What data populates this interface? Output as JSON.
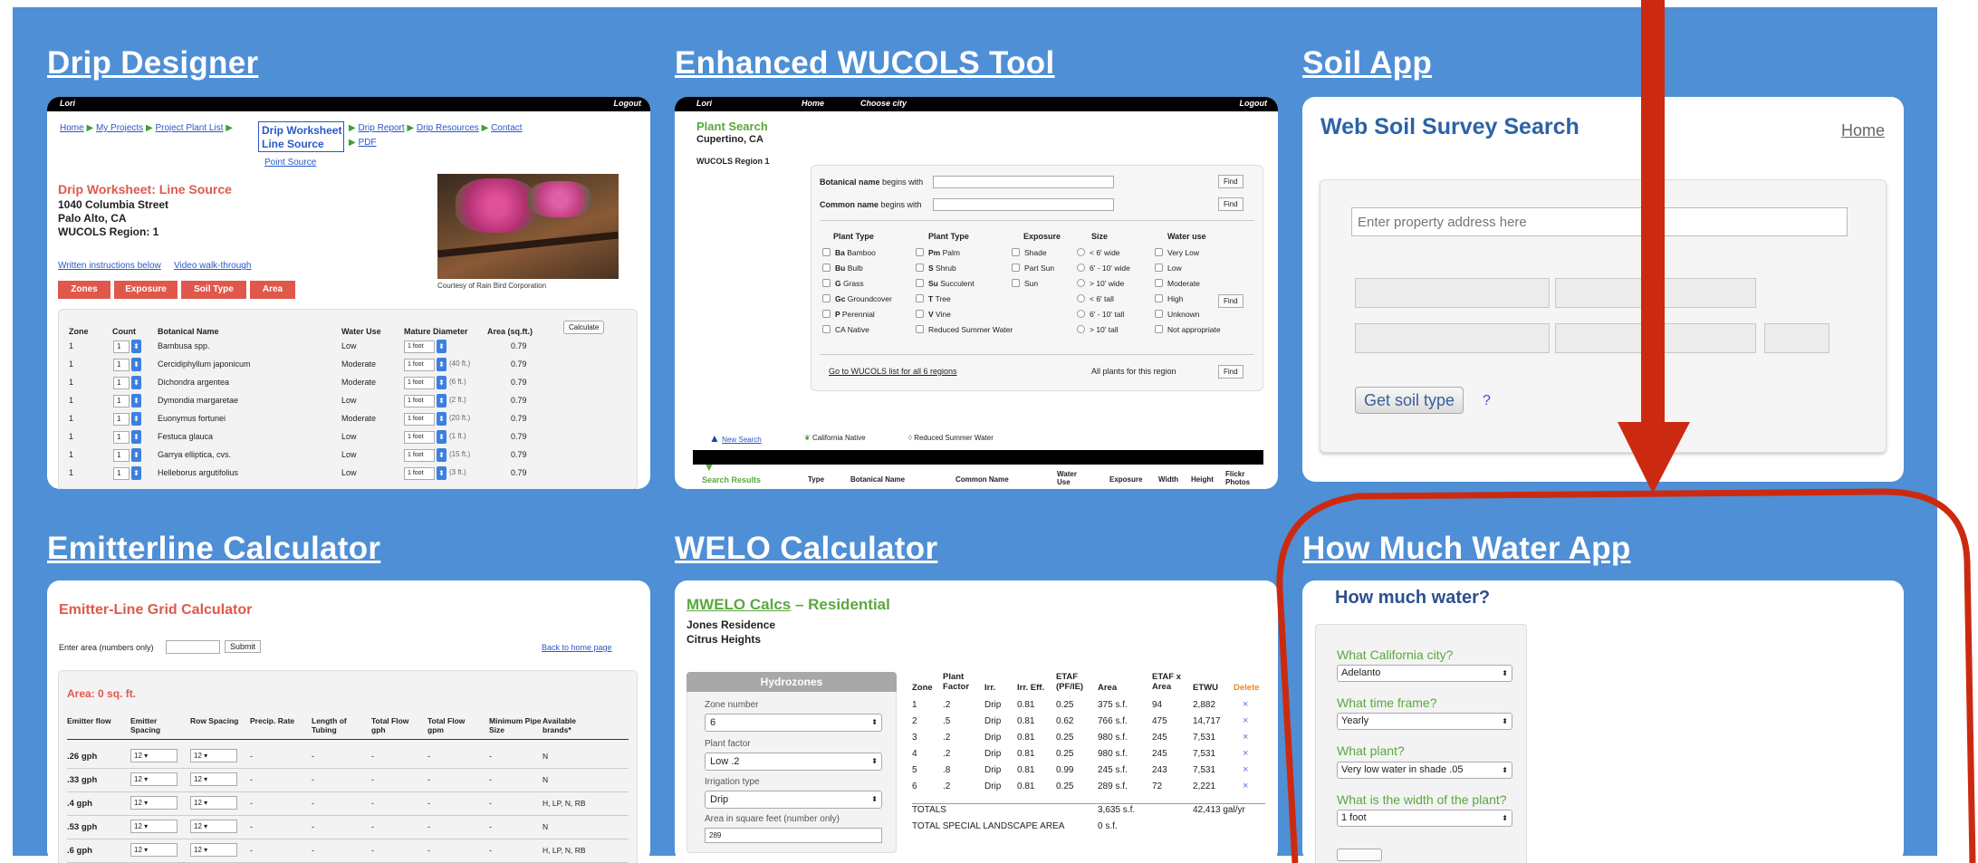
{
  "panels": {
    "drip": "Drip Designer",
    "wucols": "Enhanced WUCOLS Tool",
    "soil": "Soil App",
    "emitter": "Emitterline Calculator",
    "welo": "WELO Calculator",
    "howmuch": "How Much Water App"
  },
  "drip_designer": {
    "bar_left": "Lori",
    "bar_right": "Logout",
    "breadcrumb": [
      "Home",
      "My Projects",
      "Project Plant List"
    ],
    "active_crumb_1": "Drip Worksheet",
    "active_crumb_2": "Line Source",
    "crumb_more": [
      "Drip Report",
      "Drip Resources",
      "Contact"
    ],
    "pdf": "PDF",
    "point_source": "Point Source",
    "heading": "Drip Worksheet: Line Source",
    "address": [
      "1040 Columbia Street",
      "Palo Alto, CA",
      "WUCOLS Region: 1"
    ],
    "photo_credit": "Courtesy of Rain Bird Corporation",
    "written": "Written instructions below",
    "video": "Video walk-through",
    "tabs": [
      "Zones",
      "Exposure",
      "Soil Type",
      "Area"
    ],
    "calculate": "Calculate",
    "columns": [
      "Zone",
      "Count",
      "Botanical Name",
      "Water Use",
      "Mature Diameter",
      "Area (sq.ft.)"
    ],
    "rows": [
      {
        "zone": "1",
        "count": "1",
        "name": "Bambusa spp.",
        "use": "Low",
        "dia": "1 foot",
        "extra": "",
        "area": "0.79"
      },
      {
        "zone": "1",
        "count": "1",
        "name": "Cercidiphyllum japonicum",
        "use": "Moderate",
        "dia": "1 foot",
        "extra": "(40 ft.)",
        "area": "0.79"
      },
      {
        "zone": "1",
        "count": "1",
        "name": "Dichondra argentea",
        "use": "Moderate",
        "dia": "1 foot",
        "extra": "(6 ft.)",
        "area": "0.79"
      },
      {
        "zone": "1",
        "count": "1",
        "name": "Dymondia margaretae",
        "use": "Low",
        "dia": "1 foot",
        "extra": "(2 ft.)",
        "area": "0.79"
      },
      {
        "zone": "1",
        "count": "1",
        "name": "Euonymus fortunei",
        "use": "Moderate",
        "dia": "1 foot",
        "extra": "(20 ft.)",
        "area": "0.79"
      },
      {
        "zone": "1",
        "count": "1",
        "name": "Festuca glauca",
        "use": "Low",
        "dia": "1 foot",
        "extra": "(1 ft.)",
        "area": "0.79"
      },
      {
        "zone": "1",
        "count": "1",
        "name": "Garrya elliptica, cvs.",
        "use": "Low",
        "dia": "1 foot",
        "extra": "(15 ft.)",
        "area": "0.79"
      },
      {
        "zone": "1",
        "count": "1",
        "name": "Helleborus argutifolius",
        "use": "Low",
        "dia": "1 foot",
        "extra": "(3 ft.)",
        "area": "0.79"
      }
    ]
  },
  "wucols": {
    "bar": [
      "Lori",
      "Home",
      "Choose city",
      "Logout"
    ],
    "plant_search": "Plant Search",
    "city": "Cupertino, CA",
    "region": "WUCOLS Region 1",
    "botanical_label": "Botanical name",
    "begins": "begins with",
    "common_label": "Common name",
    "find": "Find",
    "headers": [
      "Plant Type",
      "Plant Type",
      "Exposure",
      "Size",
      "Water use"
    ],
    "col1": [
      [
        "Ba",
        "Bamboo"
      ],
      [
        "Bu",
        "Bulb"
      ],
      [
        "G",
        "Grass"
      ],
      [
        "Gc",
        "Groundcover"
      ],
      [
        "P",
        "Perennial"
      ],
      [
        "",
        "CA Native"
      ]
    ],
    "col2": [
      [
        "Pm",
        "Palm"
      ],
      [
        "S",
        "Shrub"
      ],
      [
        "Su",
        "Succulent"
      ],
      [
        "T",
        "Tree"
      ],
      [
        "V",
        "Vine"
      ],
      [
        "",
        "Reduced Summer Water"
      ]
    ],
    "col3": [
      "Shade",
      "Part Sun",
      "Sun"
    ],
    "col4": [
      "< 6' wide",
      "6' - 10' wide",
      "> 10' wide",
      "< 6' tall",
      "6' - 10' tall",
      "> 10' tall"
    ],
    "col5": [
      "Very Low",
      "Low",
      "Moderate",
      "High",
      "Unknown",
      "Not appropriate"
    ],
    "goto": "Go to WUCOLS list for all 6 regions",
    "all_plants": "All plants for this region",
    "legend": [
      "New Search",
      "California Native",
      "Reduced Summer Water"
    ],
    "results_cols": [
      "Search Results",
      "Type",
      "Botanical Name",
      "Common Name",
      "Water Use",
      "Exposure",
      "Width",
      "Height",
      "Flickr Photos"
    ]
  },
  "soil": {
    "title": "Web Soil Survey Search",
    "home": "Home",
    "placeholder": "Enter property address here",
    "button": "Get soil type",
    "help": "?"
  },
  "emitter": {
    "title": "Emitter-Line Grid Calculator",
    "enter_area": "Enter area (numbers only)",
    "submit": "Submit",
    "back": "Back to home page",
    "area": "Area: 0 sq. ft.",
    "columns": [
      "Emitter flow",
      "Emitter Spacing",
      "Row Spacing",
      "Precip. Rate",
      "Length of Tubing",
      "Total Flow gph",
      "Total Flow gpm",
      "Minimum Pipe Size",
      "Available brands*"
    ],
    "rows": [
      {
        "flow": ".26 gph",
        "es": "12",
        "rs": "12",
        "brands": "N"
      },
      {
        "flow": ".33 gph",
        "es": "12",
        "rs": "12",
        "brands": "N"
      },
      {
        "flow": ".4 gph",
        "es": "12",
        "rs": "12",
        "brands": "H, LP, N, RB"
      },
      {
        "flow": ".53 gph",
        "es": "12",
        "rs": "12",
        "brands": "N"
      },
      {
        "flow": ".6 gph",
        "es": "12",
        "rs": "12",
        "brands": "H, LP, N, RB"
      }
    ],
    "dash": "-"
  },
  "welo": {
    "title_link": "MWELO Calcs",
    "title_rest": " – Residential",
    "sub": [
      "Jones Residence",
      "Citrus Heights"
    ],
    "hydrozones": "Hydrozones",
    "zone_label": "Zone number",
    "zone_val": "6",
    "pf_label": "Plant factor",
    "pf_val": "Low .2",
    "irr_label": "Irrigation type",
    "irr_val": "Drip",
    "area_label": "Area in square feet (number only)",
    "area_val": "289",
    "columns": [
      "Zone",
      "Plant Factor",
      "Irr.",
      "Irr. Eff.",
      "ETAF (PF/IE)",
      "Area",
      "ETAF x Area",
      "ETWU",
      "Delete"
    ],
    "rows": [
      [
        "1",
        ".2",
        "Drip",
        "0.81",
        "0.25",
        "375 s.f.",
        "94",
        "2,882"
      ],
      [
        "2",
        ".5",
        "Drip",
        "0.81",
        "0.62",
        "766 s.f.",
        "475",
        "14,717"
      ],
      [
        "3",
        ".2",
        "Drip",
        "0.81",
        "0.25",
        "980 s.f.",
        "245",
        "7,531"
      ],
      [
        "4",
        ".2",
        "Drip",
        "0.81",
        "0.25",
        "980 s.f.",
        "245",
        "7,531"
      ],
      [
        "5",
        ".8",
        "Drip",
        "0.81",
        "0.99",
        "245 s.f.",
        "243",
        "7,531"
      ],
      [
        "6",
        ".2",
        "Drip",
        "0.81",
        "0.25",
        "289 s.f.",
        "72",
        "2,221"
      ]
    ],
    "totals": "TOTALS",
    "total_area": "3,635 s.f.",
    "total_etwu": "42,413 gal/yr",
    "special": "TOTAL SPECIAL LANDSCAPE AREA",
    "special_val": "0 s.f.",
    "del": "×"
  },
  "howmuch": {
    "title": "How much water?",
    "q1": "What California city?",
    "a1": "Adelanto",
    "q2": "What time frame?",
    "a2": "Yearly",
    "q3": "What plant?",
    "a3": "Very low water in shade .05",
    "q4": "What is the width of the plant?",
    "a4": "1 foot"
  },
  "colors": {
    "page_blue": "#4f8fd5",
    "annotation_red": "#cc2a10",
    "green": "#5aa83e",
    "salmon": "#e0584b"
  }
}
